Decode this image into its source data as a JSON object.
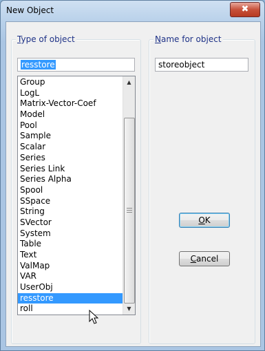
{
  "window": {
    "title": "New Object",
    "close_glyph": "✖"
  },
  "type_group": {
    "legend": "Type of object",
    "input_value": "resstore",
    "items": [
      "Group",
      "LogL",
      "Matrix-Vector-Coef",
      "Model",
      "Pool",
      "Sample",
      "Scalar",
      "Series",
      "Series Link",
      "Series Alpha",
      "Spool",
      "SSpace",
      "String",
      "SVector",
      "System",
      "Table",
      "Text",
      "ValMap",
      "VAR",
      "UserObj",
      "resstore",
      "roll"
    ],
    "selected_index": 20
  },
  "name_group": {
    "legend": "Name for object",
    "input_value": "storeobject"
  },
  "buttons": {
    "ok": "OK",
    "cancel": "Cancel"
  },
  "colors": {
    "selection": "#3399ff",
    "legend_text": "#1e3287"
  }
}
